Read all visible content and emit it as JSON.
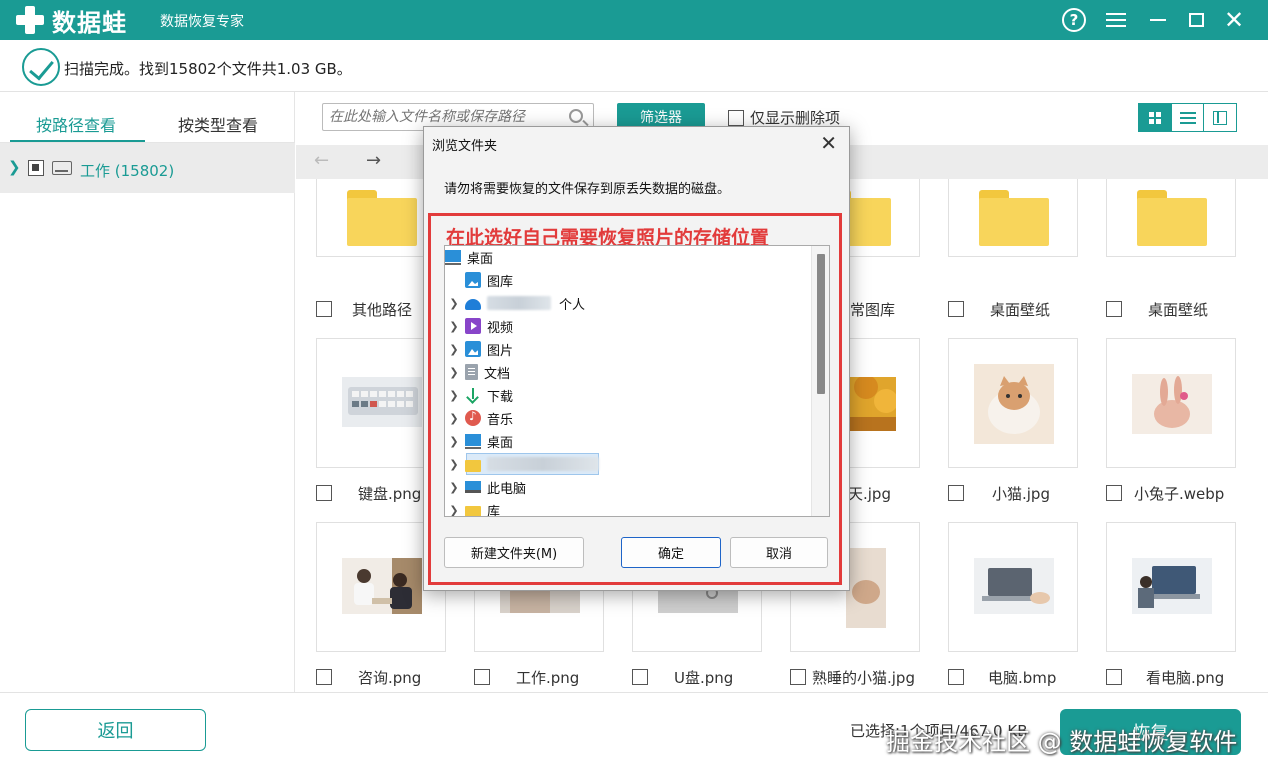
{
  "app": {
    "logo_text": "数据蛙",
    "subtitle": "数据恢复专家",
    "help_glyph": "?",
    "close_glyph": "✕"
  },
  "status": {
    "text": "扫描完成。找到15802个文件共1.03 GB。"
  },
  "sidebar": {
    "tabs": [
      {
        "label": "按路径查看",
        "active": true
      },
      {
        "label": "按类型查看",
        "active": false
      }
    ],
    "tree_root_label": "工作 (15802)"
  },
  "toolbar": {
    "search_placeholder": "在此处输入文件名称或保存路径",
    "filter_label": "筛选器",
    "only_deleted_label": "仅显示删除项"
  },
  "files": [
    {
      "label": "其他路径",
      "kind": "folder"
    },
    {
      "label": "",
      "kind": "folder"
    },
    {
      "label": "",
      "kind": "folder"
    },
    {
      "label": "常图库",
      "kind": "folder"
    },
    {
      "label": "桌面壁纸",
      "kind": "folder"
    },
    {
      "label": "桌面壁纸",
      "kind": "folder"
    },
    {
      "label": "键盘.png",
      "kind": "image"
    },
    {
      "label": "",
      "kind": "image"
    },
    {
      "label": "",
      "kind": "image"
    },
    {
      "label": "天.jpg",
      "kind": "image"
    },
    {
      "label": "小猫.jpg",
      "kind": "image"
    },
    {
      "label": "小兔子.webp",
      "kind": "image"
    },
    {
      "label": "咨询.png",
      "kind": "image"
    },
    {
      "label": "工作.png",
      "kind": "image"
    },
    {
      "label": "U盘.png",
      "kind": "image"
    },
    {
      "label": "熟睡的小猫.jpg",
      "kind": "image"
    },
    {
      "label": "电脑.bmp",
      "kind": "image"
    },
    {
      "label": "看电脑.png",
      "kind": "image"
    }
  ],
  "bottom": {
    "back_label": "返回",
    "selected_info": "已选择:1个项目/467.0 KB",
    "recover_label": "恢复",
    "watermark": "掘金技术社区 @ 数据蛙恢复软件"
  },
  "dialog": {
    "title": "浏览文件夹",
    "description": "请勿将需要恢复的文件保存到原丢失数据的磁盘。",
    "annotation": "在此选好自己需要恢复照片的存储位置",
    "tree": [
      {
        "label": "桌面",
        "icon": "desktop-icon",
        "indent": 0,
        "chev": false
      },
      {
        "label": "图库",
        "icon": "gallery-icon",
        "indent": 1,
        "chev": false
      },
      {
        "label": "个人",
        "icon": "cloud-icon",
        "indent": 1,
        "chev": true,
        "blurred": true
      },
      {
        "label": "视频",
        "icon": "video-icon",
        "indent": 1,
        "chev": true
      },
      {
        "label": "图片",
        "icon": "picture-icon",
        "indent": 1,
        "chev": true
      },
      {
        "label": "文档",
        "icon": "doc-icon",
        "indent": 1,
        "chev": true
      },
      {
        "label": "下载",
        "icon": "download-icon",
        "indent": 1,
        "chev": true
      },
      {
        "label": "音乐",
        "icon": "music-icon",
        "indent": 1,
        "chev": true
      },
      {
        "label": "桌面",
        "icon": "desktop-icon",
        "indent": 1,
        "chev": true
      },
      {
        "label": "",
        "icon": "folder-icon",
        "indent": 1,
        "chev": true,
        "blurred": true,
        "selected": true
      },
      {
        "label": "此电脑",
        "icon": "pc-icon",
        "indent": 1,
        "chev": true
      },
      {
        "label": "库",
        "icon": "library-icon",
        "indent": 1,
        "chev": true
      }
    ],
    "new_folder_label": "新建文件夹(M)",
    "ok_label": "确定",
    "cancel_label": "取消"
  },
  "colors": {
    "accent": "#1a9b94",
    "annotation_red": "#e23b3b",
    "dialog_primary_border": "#1e64c8"
  }
}
